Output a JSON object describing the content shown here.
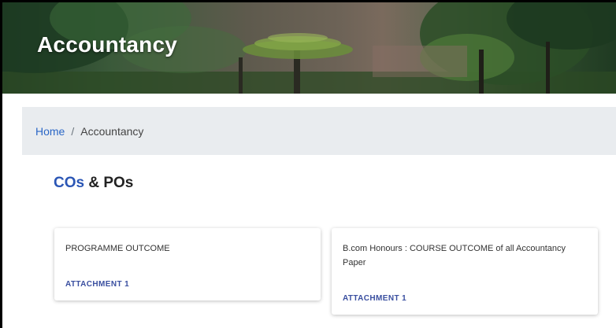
{
  "banner": {
    "title": "Accountancy"
  },
  "breadcrumb": {
    "home_label": "Home",
    "separator": "/",
    "current_label": "Accountancy"
  },
  "section": {
    "title_accent": "COs",
    "title_rest": " & POs"
  },
  "cards": [
    {
      "title": "PROGRAMME OUTCOME",
      "link_label": "ATTACHMENT 1"
    },
    {
      "title": "B.com Honours : COURSE OUTCOME of all Accountancy Paper",
      "link_label": "ATTACHMENT 1"
    }
  ],
  "colors": {
    "link": "#2b67c6",
    "accent": "#2b56b5",
    "attachment": "#3a4fa0",
    "breadcrumb_bg": "#e9ecef"
  }
}
